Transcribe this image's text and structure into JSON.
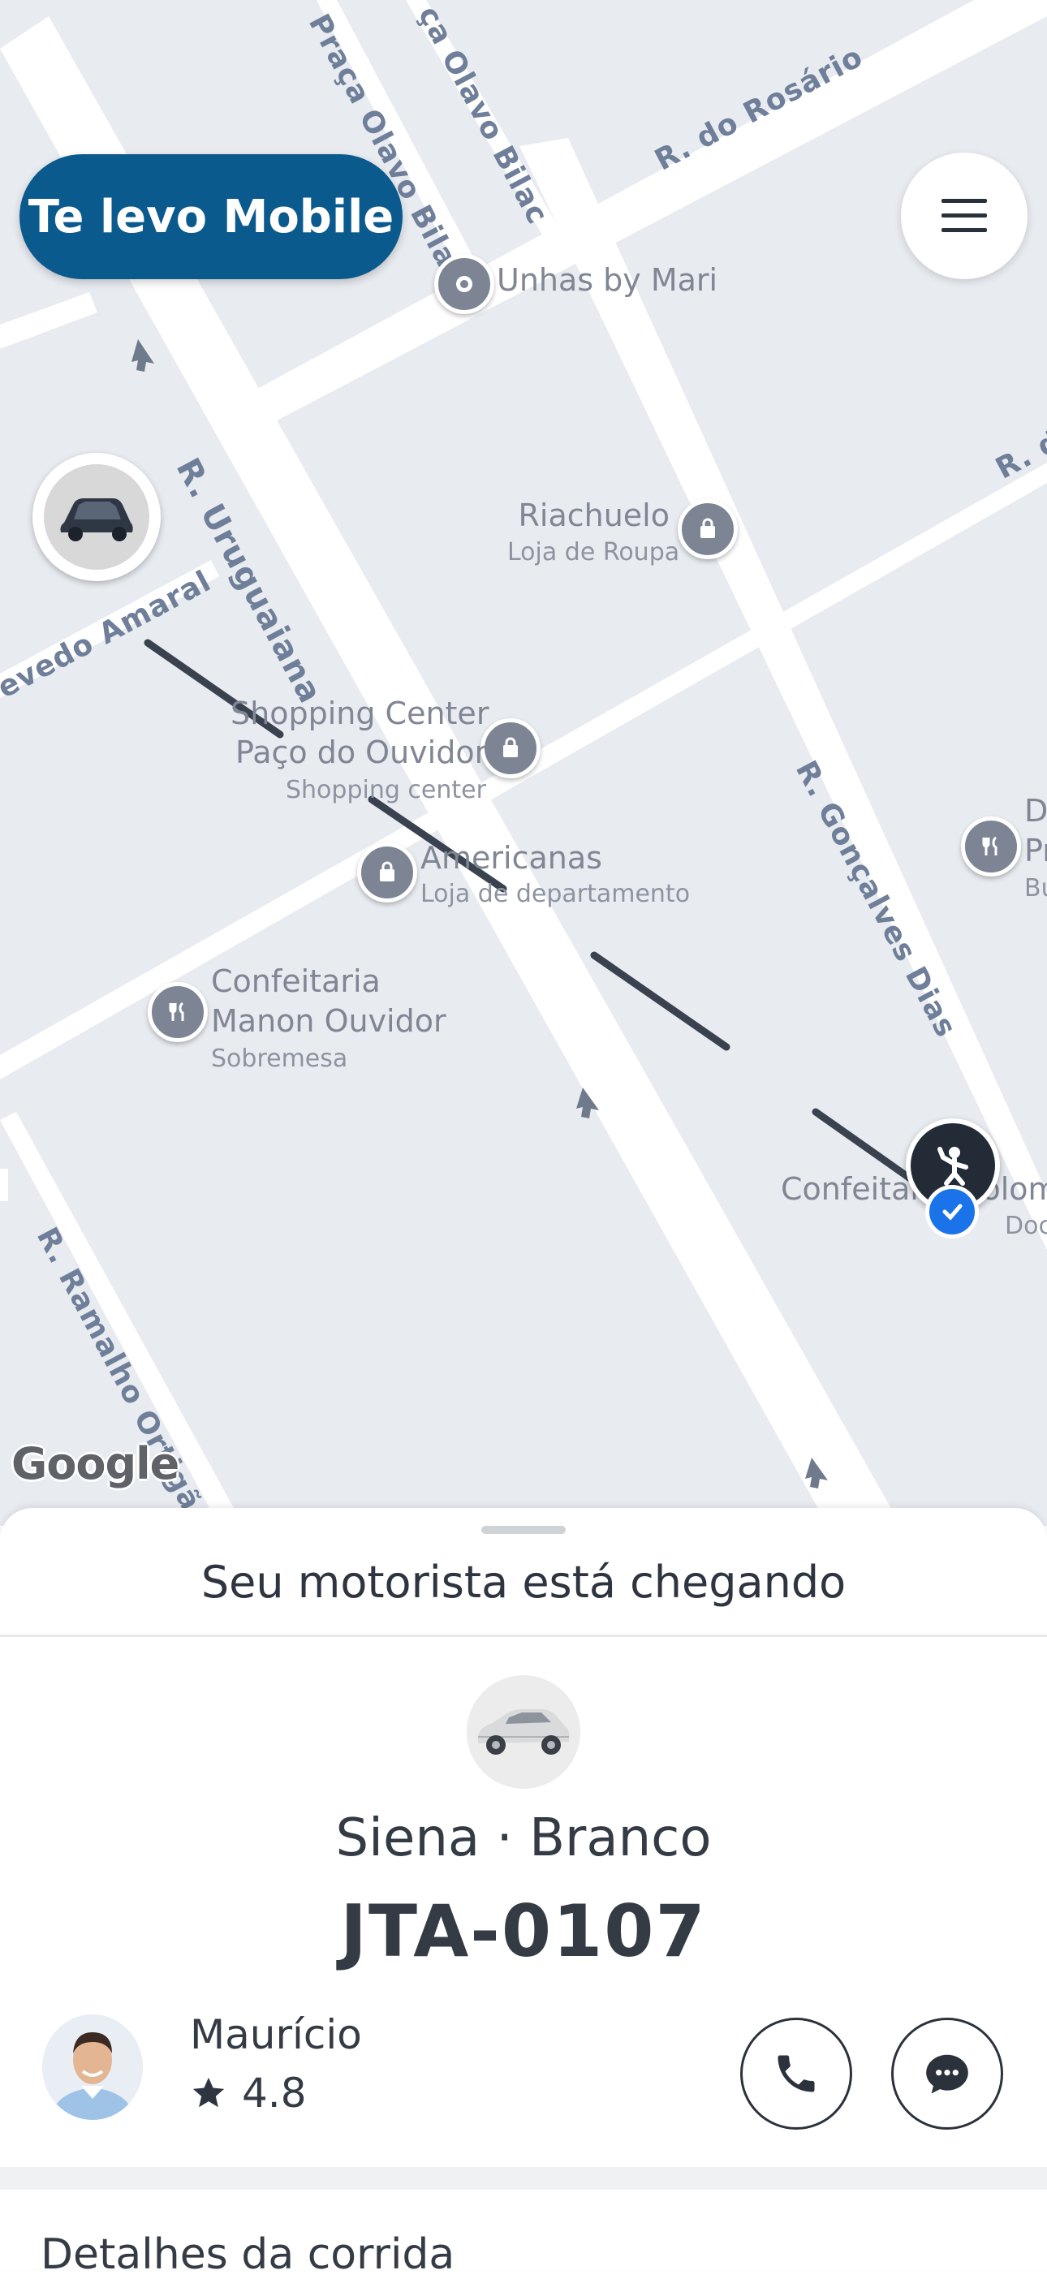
{
  "app": {
    "brand_name": "Te levo Mobile",
    "brand_color": "#0b5a8e"
  },
  "map": {
    "streets": {
      "praca_olavo_bilac_1": "Praça Olavo Bilac",
      "praca_olavo_bilac_2": "ça Olavo Bilac",
      "rosario": "R. do Rosário",
      "uruguaiana": "R. Uruguaiana",
      "amaral": "evedo Amaral",
      "goncalves_dias": "R. Gonçalves Dias",
      "ramalho_ortigao": "R. Ramalho Ortigão",
      "rd_right": "R. d"
    },
    "pois": {
      "unhas": {
        "name": "Unhas by Mari"
      },
      "riachuelo": {
        "name": "Riachuelo",
        "sub": "Loja de Roupa"
      },
      "shopping": {
        "name1": "Shopping Center",
        "name2": "Paço do Ouvidor",
        "sub": "Shopping center"
      },
      "americanas": {
        "name": "Americanas",
        "sub": "Loja de departamento"
      },
      "confeitaria_manon": {
        "name1": "Confeitaria",
        "name2": "Manon Ouvidor",
        "sub": "Sobremesa"
      },
      "confeitaria_colombo": {
        "name": "Confeitaria Colombo",
        "sub": "Doc"
      },
      "right_edge": {
        "name1": "D",
        "name2": "Pr",
        "sub": "Bu"
      }
    },
    "attribution": "Google"
  },
  "sheet": {
    "status_title": "Seu motorista está chegando",
    "vehicle": {
      "model_color": "Siena · Branco",
      "plate": "JTA-0107"
    },
    "driver": {
      "name": "Maurício",
      "rating": "4.8"
    },
    "details_title": "Detalhes da corrida"
  },
  "icons": {
    "menu": "hamburger-icon",
    "car": "car-icon",
    "passenger": "person-waving-icon",
    "phone": "phone-icon",
    "chat": "chat-bubble-icon",
    "star": "star-icon",
    "destination_check": "check-icon"
  }
}
